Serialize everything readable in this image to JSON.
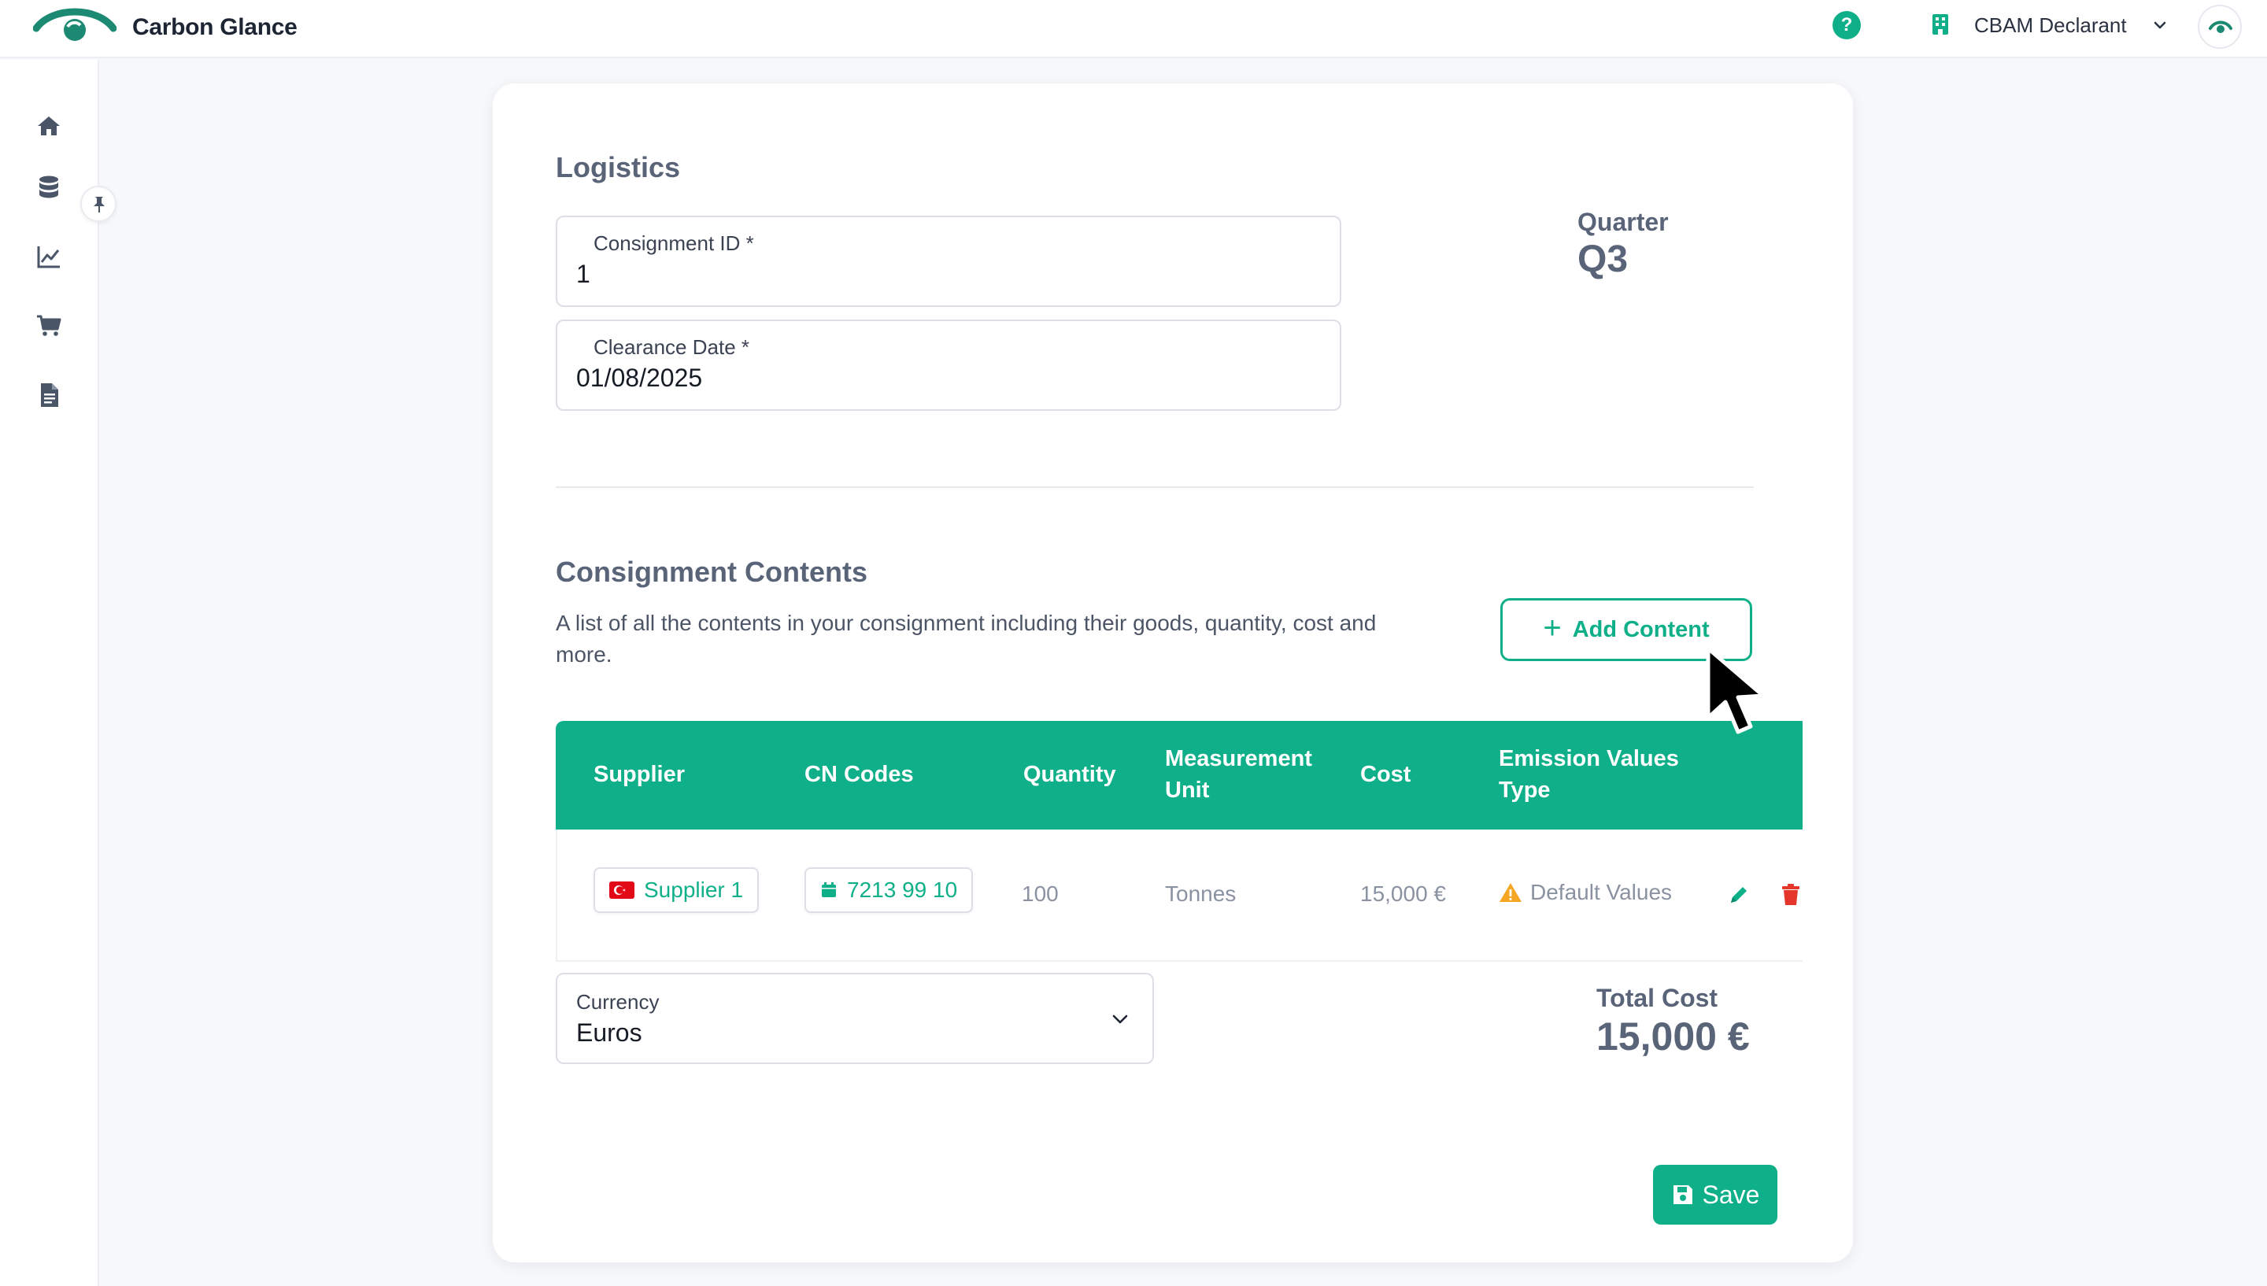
{
  "app": {
    "brand": "Carbon Glance",
    "org_name": "CBAM Declarant",
    "help_glyph": "?",
    "accent_color": "#0fb089"
  },
  "sidebar": {
    "items": [
      {
        "icon": "home-icon"
      },
      {
        "icon": "database-icon"
      },
      {
        "icon": "chart-line-icon"
      },
      {
        "icon": "cart-icon"
      },
      {
        "icon": "document-icon"
      }
    ]
  },
  "logistics": {
    "title": "Logistics",
    "consignment_id_label": "Consignment ID *",
    "consignment_id_value": "1",
    "clearance_date_label": "Clearance Date *",
    "clearance_date_value": "01/08/2025",
    "quarter_label": "Quarter",
    "quarter_value": "Q3"
  },
  "contents": {
    "title": "Consignment Contents",
    "description": "A list of all the contents in your consignment including their goods, quantity, cost and more.",
    "add_button": "Add Content",
    "columns": [
      "Supplier",
      "CN Codes",
      "Quantity",
      "Measurement Unit",
      "Cost",
      "Emission Values Type"
    ],
    "rows": [
      {
        "supplier": "Supplier 1",
        "cn_code": "7213 99 10",
        "quantity": "100",
        "unit": "Tonnes",
        "cost": "15,000 €",
        "emission_type": "Default Values"
      }
    ],
    "currency_label": "Currency",
    "currency_value": "Euros",
    "total_label": "Total Cost",
    "total_value": "15,000 €"
  },
  "actions": {
    "save": "Save"
  }
}
